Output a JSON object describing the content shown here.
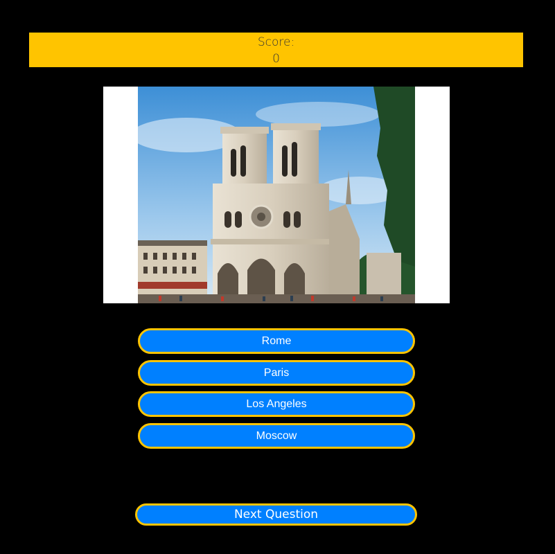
{
  "score": {
    "label": "Score:",
    "value": "0"
  },
  "photo": {
    "subject": "cathedral-photo"
  },
  "answers": [
    {
      "label": "Rome"
    },
    {
      "label": "Paris"
    },
    {
      "label": "Los Angeles"
    },
    {
      "label": "Moscow"
    }
  ],
  "next_button": {
    "label": "Next Question"
  },
  "colors": {
    "background": "#000000",
    "score_bar": "#FFC400",
    "button_fill": "#0080FF",
    "button_border": "#FFC400"
  }
}
